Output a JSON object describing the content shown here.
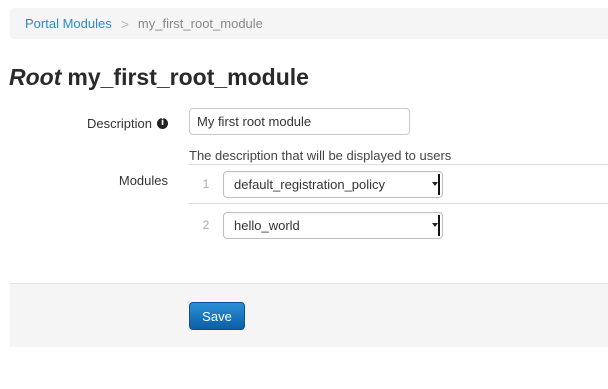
{
  "breadcrumb": {
    "parent": "Portal Modules",
    "separator": ">",
    "current": "my_first_root_module"
  },
  "header": {
    "kind": "Root",
    "name": "my_first_root_module"
  },
  "form": {
    "description_label": "Description",
    "info_icon": "info-icon",
    "description_value": "My first root module",
    "help_text": "The description that will be displayed to users",
    "modules_label": "Modules",
    "modules": [
      {
        "index": "1",
        "value": "default_registration_policy"
      },
      {
        "index": "2",
        "value": "hello_world"
      }
    ],
    "save_label": "Save"
  },
  "colors": {
    "link": "#2a8bc5",
    "primary_button": "#0a6ab7",
    "panel_background": "#f5f5f5"
  }
}
